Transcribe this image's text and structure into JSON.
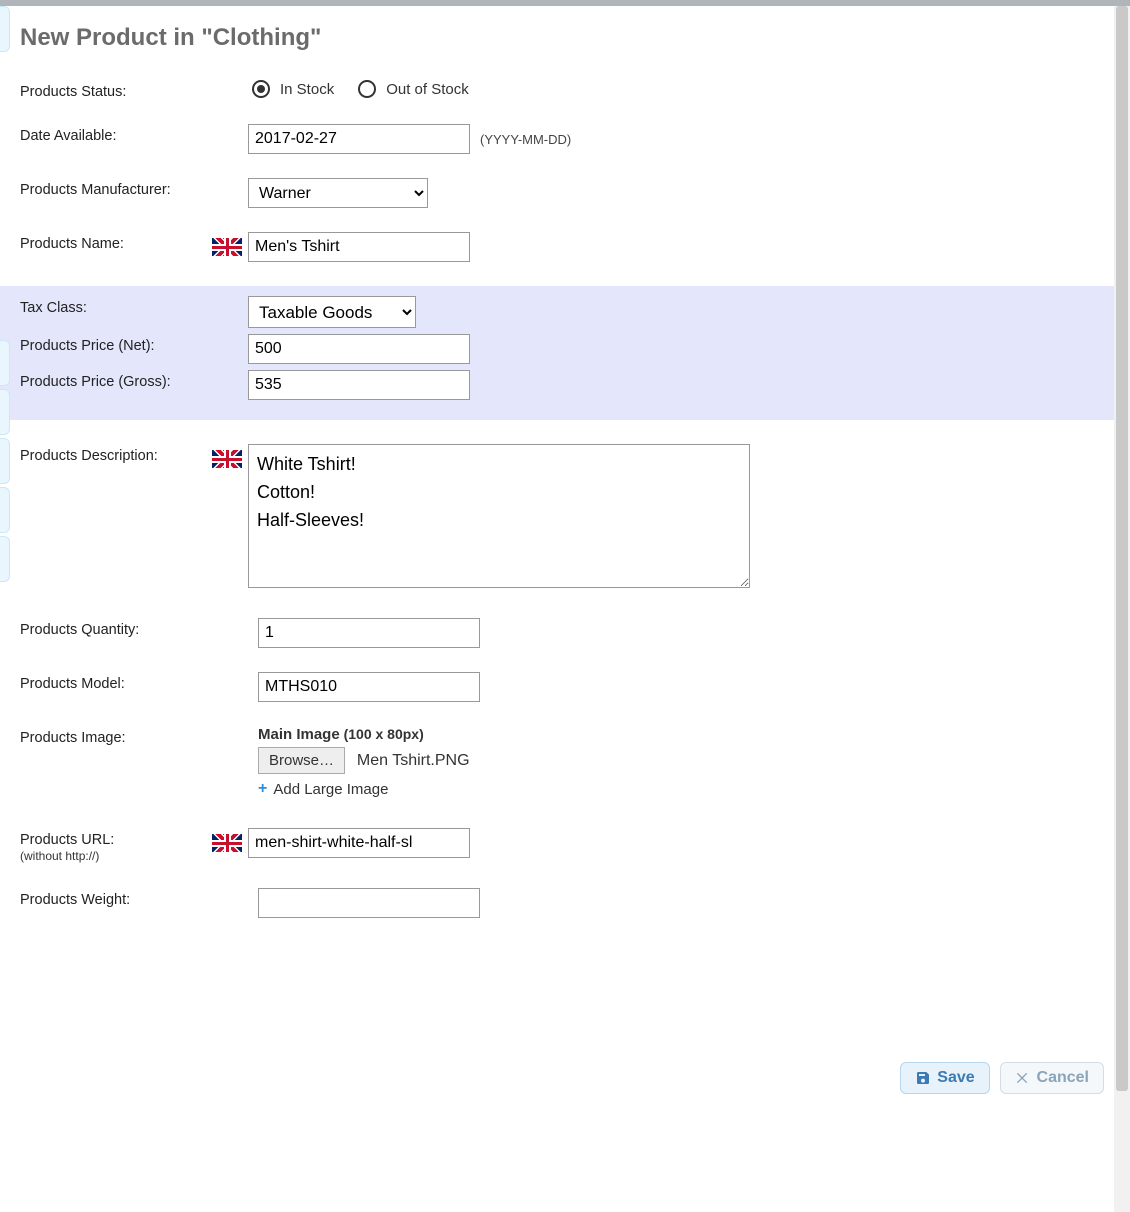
{
  "title": "New Product in \"Clothing\"",
  "status": {
    "label": "Products Status:",
    "in_stock": "In Stock",
    "out_of_stock": "Out of Stock",
    "selected": "in_stock"
  },
  "date_available": {
    "label": "Date Available:",
    "value": "2017-02-27",
    "hint": "(YYYY-MM-DD)"
  },
  "manufacturer": {
    "label": "Products Manufacturer:",
    "selected": "Warner"
  },
  "name": {
    "label": "Products Name:",
    "value": "Men's Tshirt"
  },
  "tax_class": {
    "label": "Tax Class:",
    "selected": "Taxable Goods"
  },
  "price_net": {
    "label": "Products Price (Net):",
    "value": "500"
  },
  "price_gross": {
    "label": "Products Price (Gross):",
    "value": "535"
  },
  "description": {
    "label": "Products Description:",
    "value": "White Tshirt!\nCotton!\nHalf-Sleeves!"
  },
  "quantity": {
    "label": "Products Quantity:",
    "value": "1"
  },
  "model": {
    "label": "Products Model:",
    "value": "MTHS010"
  },
  "image": {
    "label": "Products Image:",
    "main_label": "Main Image",
    "main_dim": "(100 x 80px)",
    "browse": "Browse…",
    "file": "Men Tshirt.PNG",
    "add_large": "Add Large Image"
  },
  "url": {
    "label": "Products URL:",
    "sublabel": "(without http://)",
    "value": "men-shirt-white-half-sl"
  },
  "weight": {
    "label": "Products Weight:",
    "value": ""
  },
  "buttons": {
    "save": "Save",
    "cancel": "Cancel"
  }
}
